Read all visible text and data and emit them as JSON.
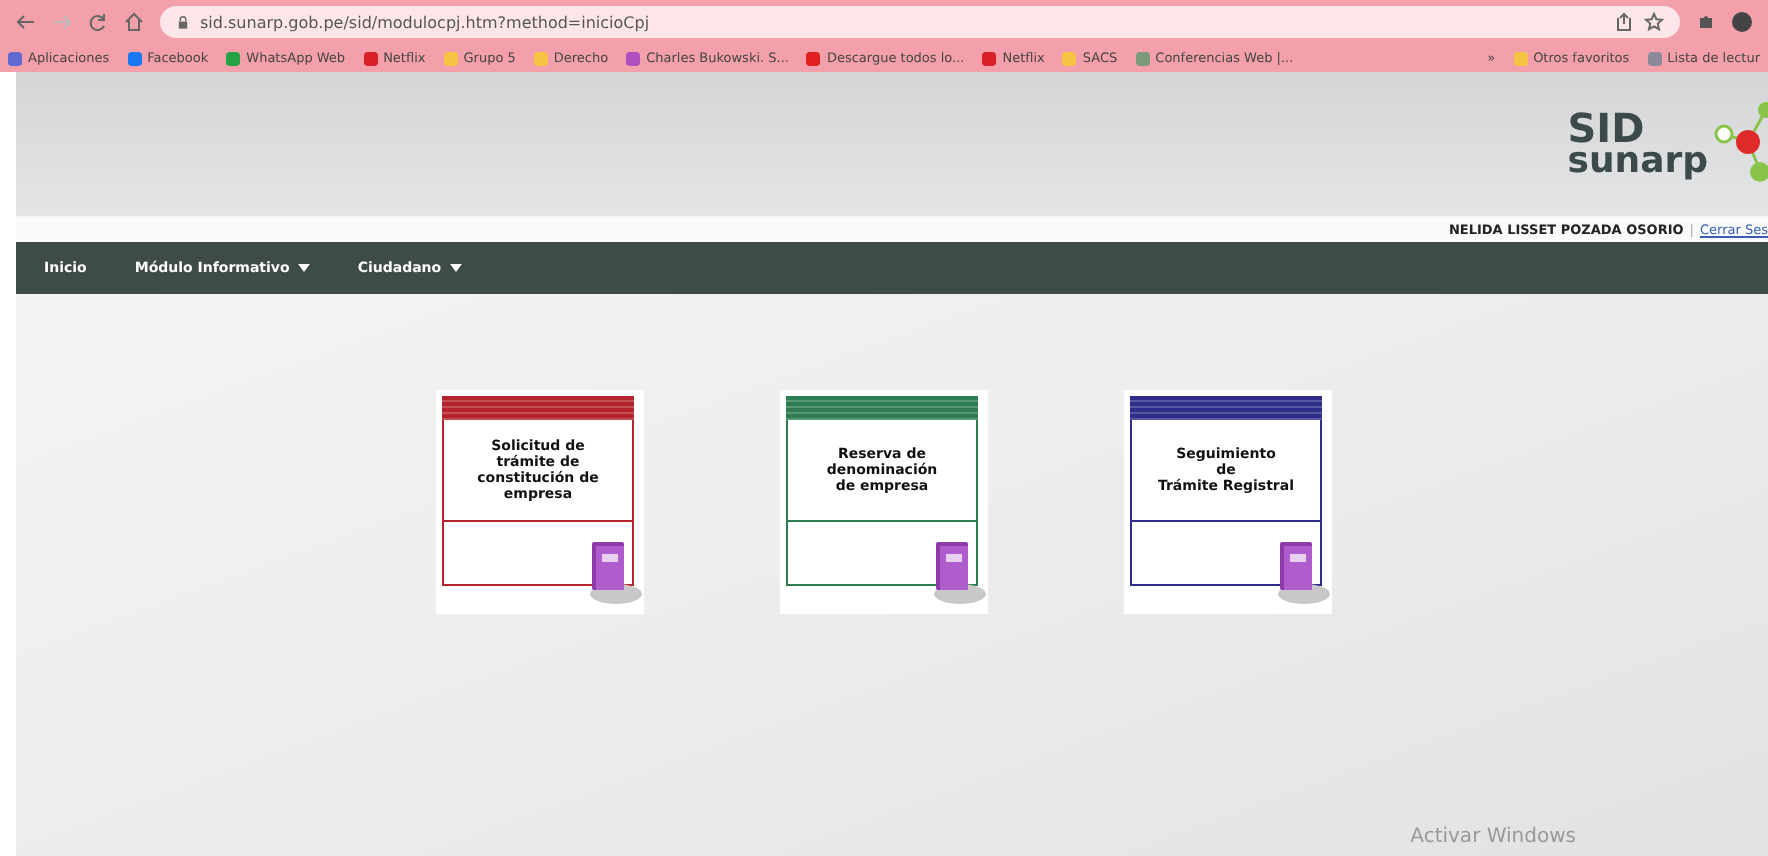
{
  "browser": {
    "url": "sid.sunarp.gob.pe/sid/modulocpj.htm?method=inicioCpj",
    "bookmarks": [
      {
        "label": "Aplicaciones",
        "color": "#5f6bd0"
      },
      {
        "label": "Facebook",
        "color": "#1877f2"
      },
      {
        "label": "WhatsApp Web",
        "color": "#25a244"
      },
      {
        "label": "Netflix",
        "color": "#d81f26"
      },
      {
        "label": "Grupo 5",
        "color": "#f5c542"
      },
      {
        "label": "Derecho",
        "color": "#f5c542"
      },
      {
        "label": "Charles Bukowski. S...",
        "color": "#b04fc0"
      },
      {
        "label": "Descargue todos lo...",
        "color": "#e02020"
      },
      {
        "label": "Netflix",
        "color": "#d81f26"
      },
      {
        "label": "SACS",
        "color": "#f5c542"
      },
      {
        "label": "Conferencias Web |...",
        "color": "#7a9a7a"
      }
    ],
    "overflow": "»",
    "other_bookmarks": [
      {
        "label": "Otros favoritos",
        "color": "#f5c542"
      },
      {
        "label": "Lista de lectur",
        "color": "#8a8a9a"
      }
    ]
  },
  "header": {
    "logo_top": "SID",
    "logo_bottom": "sunarp",
    "user": "NELIDA LISSET POZADA OSORIO",
    "separator": "|",
    "logout": "Cerrar Ses"
  },
  "nav": [
    {
      "label": "Inicio",
      "dropdown": false
    },
    {
      "label": "Módulo Informativo",
      "dropdown": true
    },
    {
      "label": "Ciudadano",
      "dropdown": true
    }
  ],
  "cards": [
    {
      "title": "Solicitud de\ntrámite de\nconstitución de\nempresa",
      "color": "#b5242c"
    },
    {
      "title": "Reserva de\ndenominación\nde empresa",
      "color": "#2e7d52"
    },
    {
      "title": "Seguimiento\nde\nTrámite Registral",
      "color": "#2e2e8a"
    }
  ],
  "os_notice": "Activar Windows"
}
